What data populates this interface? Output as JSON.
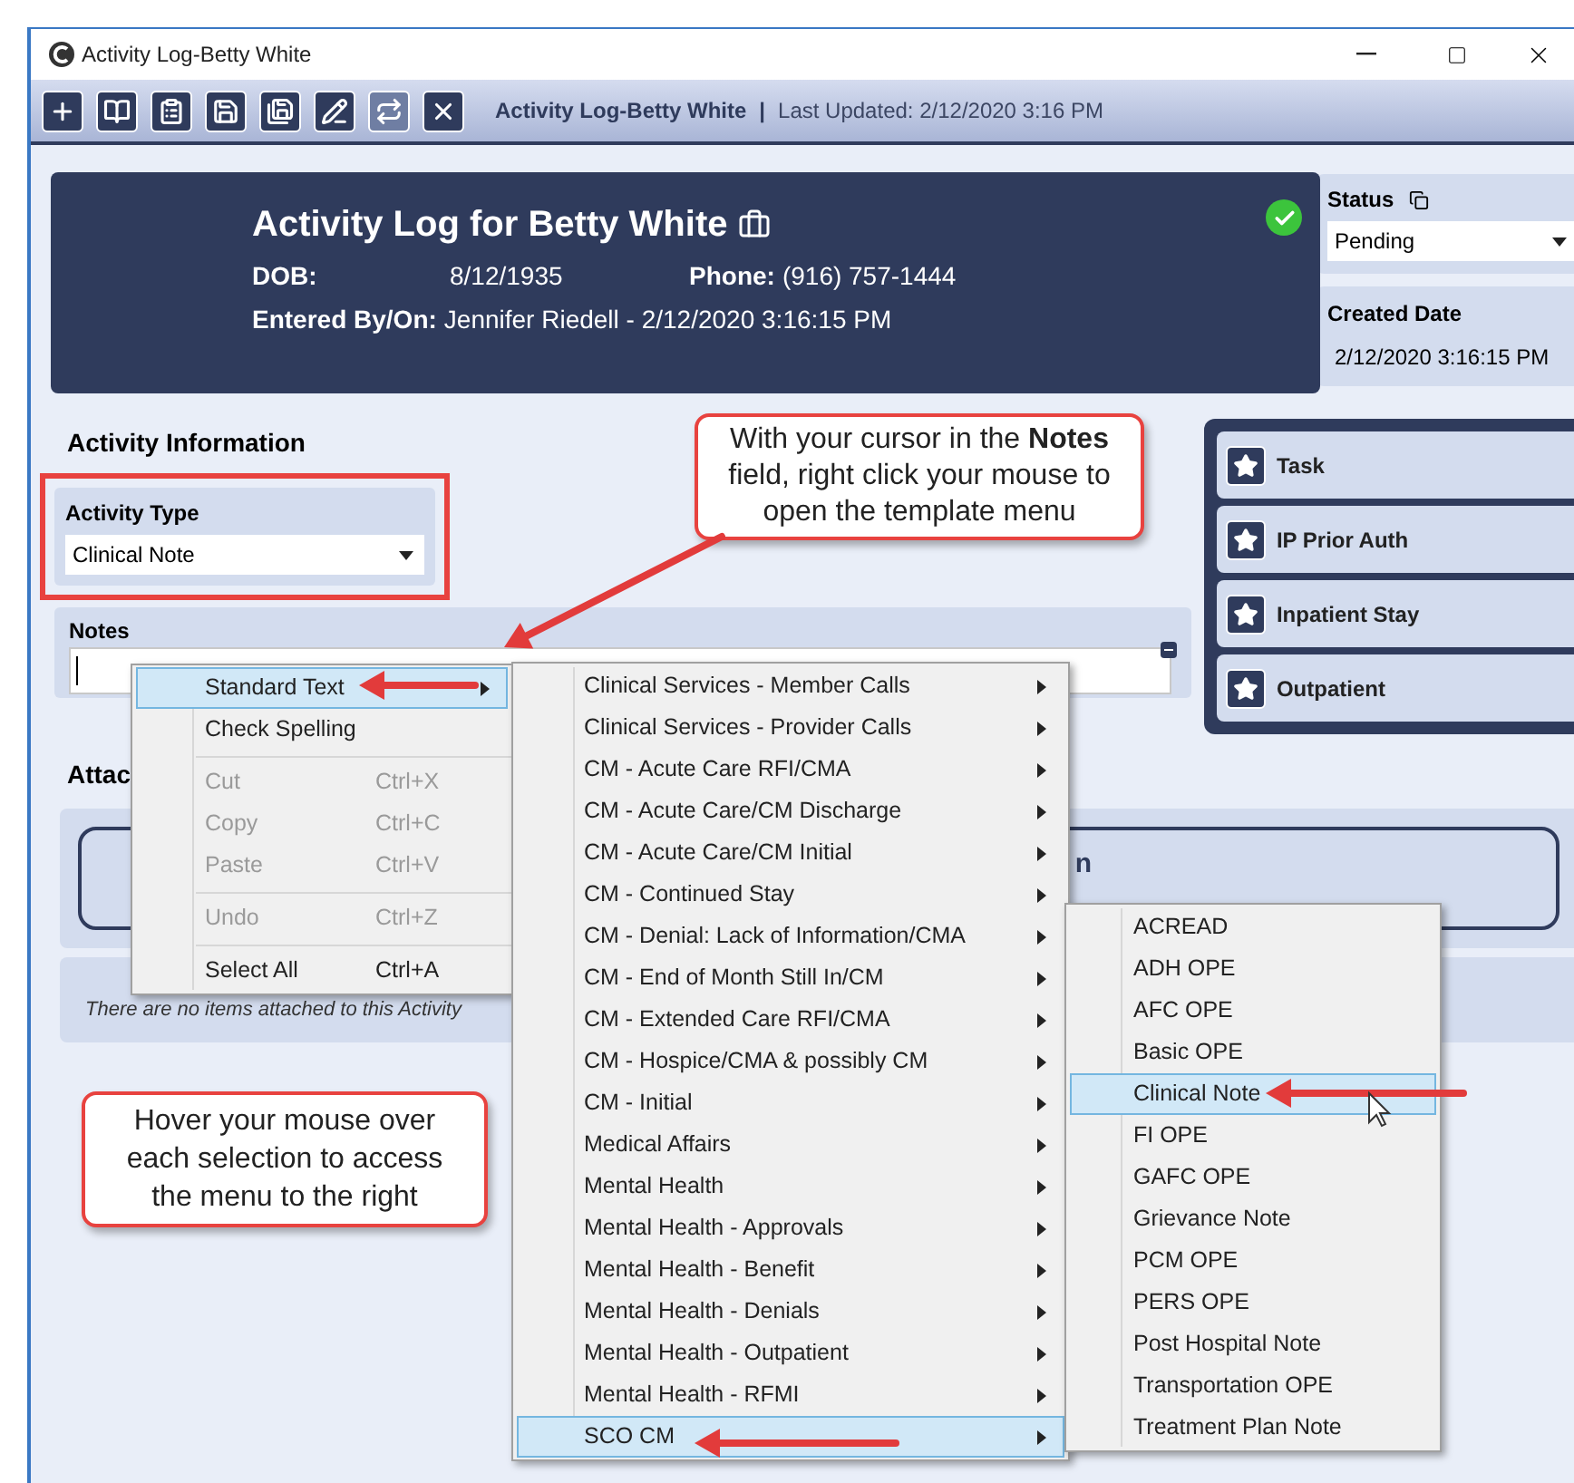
{
  "window": {
    "title": "Activity Log-Betty White"
  },
  "toolbar": {
    "title": "Activity Log-Betty White",
    "separator": "|",
    "last_updated": "Last Updated: 2/12/2020 3:16 PM"
  },
  "header": {
    "title": "Activity Log for Betty White",
    "dob_label": "DOB:",
    "dob": "8/12/1935",
    "phone_label": "Phone:",
    "phone": "(916) 757-1444",
    "entered_label": "Entered By/On:",
    "entered": "Jennifer Riedell - 2/12/2020 3:16:15 PM"
  },
  "status": {
    "label": "Status",
    "value": "Pending"
  },
  "created": {
    "label": "Created Date",
    "value": "2/12/2020 3:16:15 PM"
  },
  "activity_information": {
    "heading": "Activity Information",
    "type_label": "Activity Type",
    "type_value": "Clinical Note",
    "notes_label": "Notes"
  },
  "actions": [
    "Task",
    "IP Prior Auth",
    "Inpatient Stay",
    "Outpatient"
  ],
  "attachments": {
    "heading": "Attac",
    "drop_text": "n",
    "empty_text": "There are no items attached to this Activity"
  },
  "context_menu": {
    "items": [
      {
        "kind": "item",
        "label": "Standard Text",
        "submenu": true,
        "selected": true,
        "disabled": false
      },
      {
        "kind": "item",
        "label": "Check Spelling",
        "submenu": false,
        "selected": false,
        "disabled": false
      },
      {
        "kind": "separator"
      },
      {
        "kind": "item",
        "label": "Cut",
        "shortcut": "Ctrl+X",
        "submenu": false,
        "selected": false,
        "disabled": true
      },
      {
        "kind": "item",
        "label": "Copy",
        "shortcut": "Ctrl+C",
        "submenu": false,
        "selected": false,
        "disabled": true
      },
      {
        "kind": "item",
        "label": "Paste",
        "shortcut": "Ctrl+V",
        "submenu": false,
        "selected": false,
        "disabled": true
      },
      {
        "kind": "separator"
      },
      {
        "kind": "item",
        "label": "Undo",
        "shortcut": "Ctrl+Z",
        "submenu": false,
        "selected": false,
        "disabled": true
      },
      {
        "kind": "separator"
      },
      {
        "kind": "item",
        "label": "Select All",
        "shortcut": "Ctrl+A",
        "submenu": false,
        "selected": false,
        "disabled": false
      }
    ]
  },
  "standard_text_menu": {
    "items": [
      {
        "label": "Clinical Services - Member Calls",
        "selected": false
      },
      {
        "label": "Clinical Services - Provider Calls",
        "selected": false
      },
      {
        "label": "CM - Acute Care RFI/CMA",
        "selected": false
      },
      {
        "label": "CM - Acute Care/CM Discharge",
        "selected": false
      },
      {
        "label": "CM - Acute Care/CM Initial",
        "selected": false
      },
      {
        "label": "CM - Continued Stay",
        "selected": false
      },
      {
        "label": "CM - Denial: Lack of Information/CMA",
        "selected": false
      },
      {
        "label": "CM - End of Month Still In/CM",
        "selected": false
      },
      {
        "label": "CM - Extended Care RFI/CMA",
        "selected": false
      },
      {
        "label": "CM - Hospice/CMA & possibly CM",
        "selected": false
      },
      {
        "label": "CM - Initial",
        "selected": false
      },
      {
        "label": "Medical Affairs",
        "selected": false
      },
      {
        "label": "Mental Health",
        "selected": false
      },
      {
        "label": "Mental Health - Approvals",
        "selected": false
      },
      {
        "label": "Mental Health - Benefit",
        "selected": false
      },
      {
        "label": "Mental Health - Denials",
        "selected": false
      },
      {
        "label": "Mental Health - Outpatient",
        "selected": false
      },
      {
        "label": "Mental Health - RFMI",
        "selected": false
      },
      {
        "label": "SCO CM",
        "selected": true
      }
    ]
  },
  "template_menu": {
    "items": [
      {
        "label": "ACREAD",
        "selected": false
      },
      {
        "label": "ADH OPE",
        "selected": false
      },
      {
        "label": "AFC OPE",
        "selected": false
      },
      {
        "label": "Basic OPE",
        "selected": false
      },
      {
        "label": "Clinical Note",
        "selected": true
      },
      {
        "label": "FI OPE",
        "selected": false
      },
      {
        "label": "GAFC OPE",
        "selected": false
      },
      {
        "label": "Grievance Note",
        "selected": false
      },
      {
        "label": "PCM OPE",
        "selected": false
      },
      {
        "label": "PERS OPE",
        "selected": false
      },
      {
        "label": "Post Hospital Note",
        "selected": false
      },
      {
        "label": "Transportation OPE",
        "selected": false
      },
      {
        "label": "Treatment Plan Note",
        "selected": false
      }
    ]
  },
  "callouts": [
    {
      "text": "With your cursor in the **Notes** field, right click your mouse to open the template menu"
    },
    {
      "text": "Hover your mouse over each selection to access the menu to the right"
    }
  ]
}
